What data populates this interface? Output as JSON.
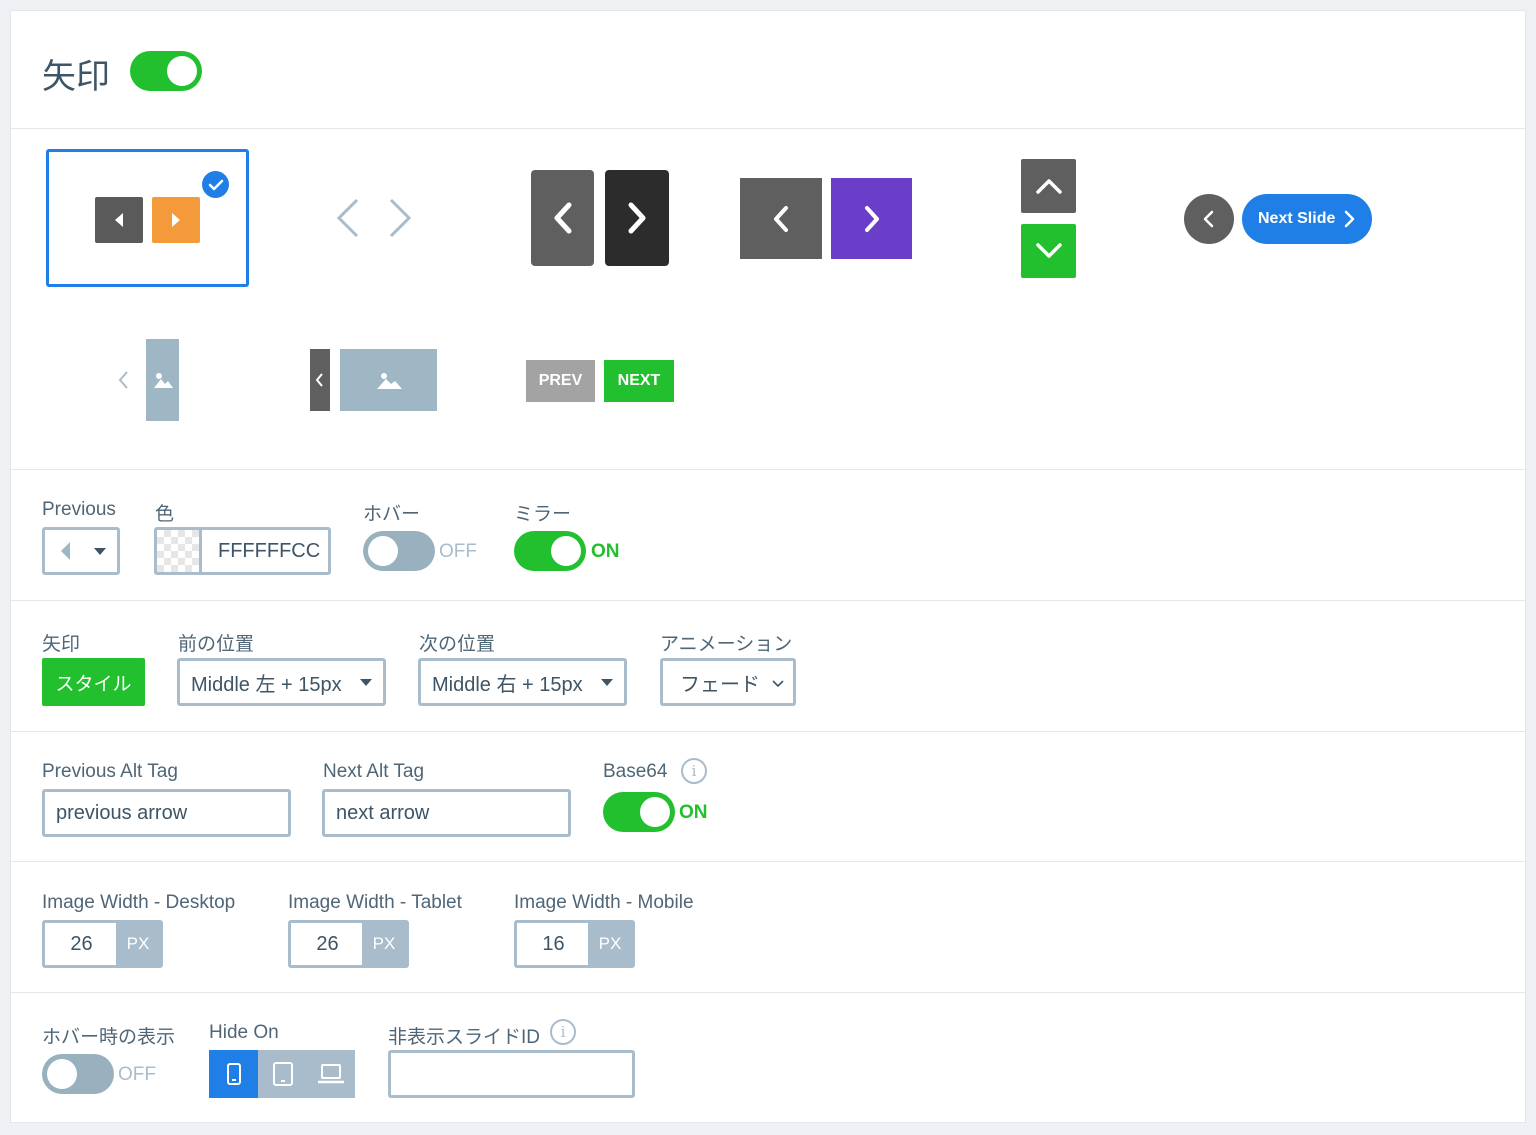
{
  "header": {
    "title": "矢印",
    "enabled": true
  },
  "styles": {
    "next_slide_label": "Next Slide",
    "prev_label": "PREV",
    "next_label": "NEXT",
    "selected_index": 0
  },
  "row_previous": {
    "previous_label": "Previous",
    "color_label": "色",
    "color_value": "FFFFFFCC",
    "hover_label": "ホバー",
    "hover_state": "OFF",
    "mirror_label": "ミラー",
    "mirror_state": "ON"
  },
  "row_arrow": {
    "arrow_label": "矢印",
    "style_button": "スタイル",
    "prev_position_label": "前の位置",
    "prev_position_value": "Middle 左 + 15px",
    "next_position_label": "次の位置",
    "next_position_value": "Middle 右 + 15px",
    "animation_label": "アニメーション",
    "animation_value": "フェード"
  },
  "row_alt": {
    "prev_alt_label": "Previous Alt Tag",
    "prev_alt_value": "previous arrow",
    "next_alt_label": "Next Alt Tag",
    "next_alt_value": "next arrow",
    "base64_label": "Base64",
    "base64_state": "ON"
  },
  "row_width": {
    "desktop_label": "Image Width - Desktop",
    "desktop_value": "26",
    "tablet_label": "Image Width - Tablet",
    "tablet_value": "26",
    "mobile_label": "Image Width - Mobile",
    "mobile_value": "16",
    "unit": "PX"
  },
  "row_hide": {
    "hover_show_label": "ホバー時の表示",
    "hover_show_state": "OFF",
    "hide_on_label": "Hide On",
    "hidden_ids_label": "非表示スライドID",
    "hidden_ids_value": ""
  },
  "colors": {
    "green": "#22c02e",
    "blue": "#1f7fe6",
    "orange": "#f59a3a",
    "purple": "#6a3ec9",
    "grey_dark": "#5a5a5a"
  }
}
